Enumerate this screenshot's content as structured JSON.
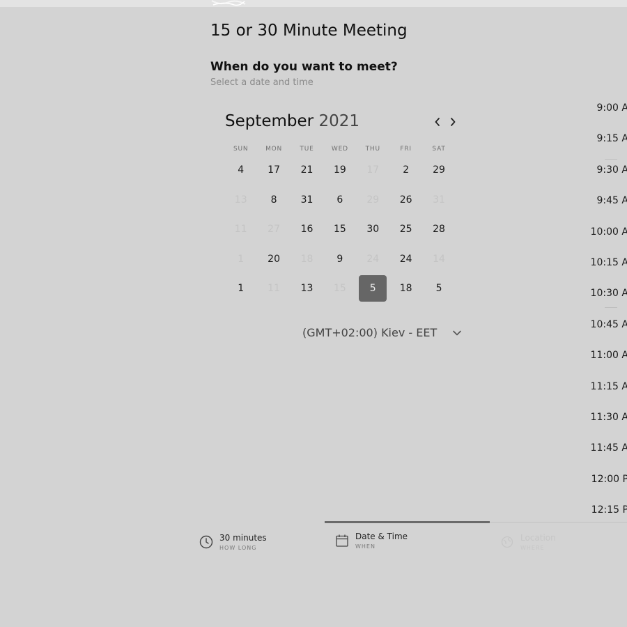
{
  "header": {
    "title": "15 or 30 Minute Meeting",
    "question": "When do you want to meet?",
    "hint": "Select a date and time"
  },
  "calendar": {
    "month": "September",
    "year": "2021",
    "weekdays": [
      "SUN",
      "MON",
      "TUE",
      "WED",
      "THU",
      "FRI",
      "SAT"
    ],
    "weeks": [
      [
        {
          "d": "4",
          "off": false
        },
        {
          "d": "17",
          "off": false
        },
        {
          "d": "21",
          "off": false
        },
        {
          "d": "19",
          "off": false
        },
        {
          "d": "17",
          "off": true
        },
        {
          "d": "2",
          "off": false
        },
        {
          "d": "29",
          "off": false
        }
      ],
      [
        {
          "d": "13",
          "off": true
        },
        {
          "d": "8",
          "off": false
        },
        {
          "d": "31",
          "off": false
        },
        {
          "d": "6",
          "off": false
        },
        {
          "d": "29",
          "off": true
        },
        {
          "d": "26",
          "off": false
        },
        {
          "d": "31",
          "off": true
        }
      ],
      [
        {
          "d": "11",
          "off": true
        },
        {
          "d": "27",
          "off": true
        },
        {
          "d": "16",
          "off": false
        },
        {
          "d": "15",
          "off": false
        },
        {
          "d": "30",
          "off": false
        },
        {
          "d": "25",
          "off": false
        },
        {
          "d": "28",
          "off": false
        }
      ],
      [
        {
          "d": "1",
          "off": true
        },
        {
          "d": "20",
          "off": false
        },
        {
          "d": "18",
          "off": true
        },
        {
          "d": "9",
          "off": false
        },
        {
          "d": "24",
          "off": true
        },
        {
          "d": "24",
          "off": false
        },
        {
          "d": "14",
          "off": true
        }
      ],
      [
        {
          "d": "1",
          "off": false
        },
        {
          "d": "11",
          "off": true
        },
        {
          "d": "13",
          "off": false
        },
        {
          "d": "15",
          "off": true
        },
        {
          "d": "5",
          "off": false,
          "selected": true
        },
        {
          "d": "18",
          "off": false
        },
        {
          "d": "5",
          "off": false
        }
      ]
    ]
  },
  "timezone": {
    "label": "(GMT+02:00) Kiev - EET"
  },
  "times": [
    "9:00 AM",
    "9:15 AM",
    "9:30 AM",
    "9:45 AM",
    "10:00 AM",
    "10:15 AM",
    "10:30 AM",
    "10:45 AM",
    "11:00 AM",
    "11:15 AM",
    "11:30 AM",
    "11:45 AM",
    "12:00 PM",
    "12:15 PM"
  ],
  "steps": [
    {
      "main": "30 minutes",
      "sub": "HOW LONG",
      "icon": "clock-icon"
    },
    {
      "main": "Date & Time",
      "sub": "WHEN",
      "icon": "calendar-icon"
    },
    {
      "main": "Location",
      "sub": "WHERE",
      "icon": "location-icon"
    }
  ],
  "colors": {
    "background": "#d3d3d3",
    "selected_day": "#666666",
    "progress": "#6a6a6a"
  },
  "progress": {
    "current_step": 2,
    "total_steps": 3
  }
}
